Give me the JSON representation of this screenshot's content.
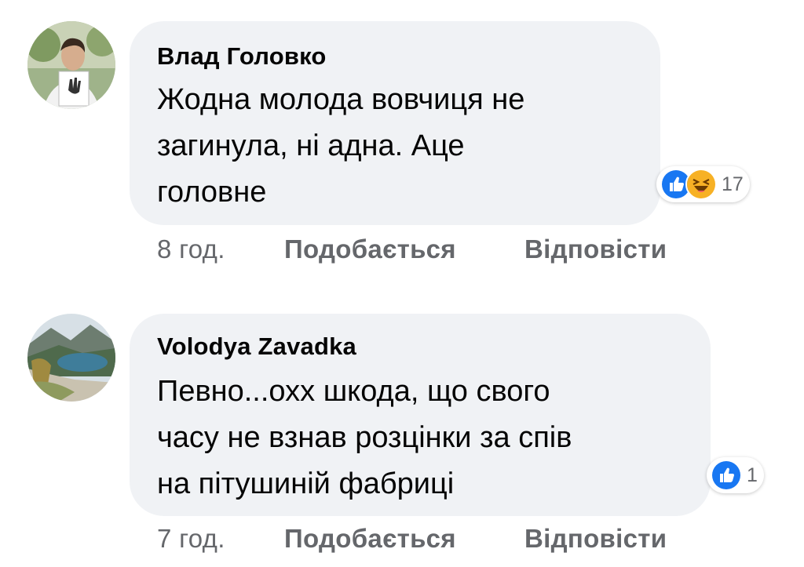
{
  "comments": [
    {
      "author": "Влад Головко",
      "text": "Жодна молода вовчиця не\nзагинула, ні адна. Аце\nголовне",
      "reaction_count": "17",
      "reactions": [
        "like-icon",
        "haha-icon"
      ],
      "time": "8 год.",
      "like_label": "Подобається",
      "reply_label": "Відповісти"
    },
    {
      "author": "Volodya Zavadka",
      "text": "Певно...охх шкода, що свого\nчасу не взнав розцінки за спів\nна пітушиній фабриці",
      "reaction_count": "1",
      "reactions": [
        "like-icon"
      ],
      "time": "7 год.",
      "like_label": "Подобається",
      "reply_label": "Відповісти"
    }
  ],
  "colors": {
    "bubble": "#f0f2f5",
    "like_blue": "#1877f2",
    "haha_yellow": "#f7b125",
    "meta_gray": "#65676b"
  }
}
